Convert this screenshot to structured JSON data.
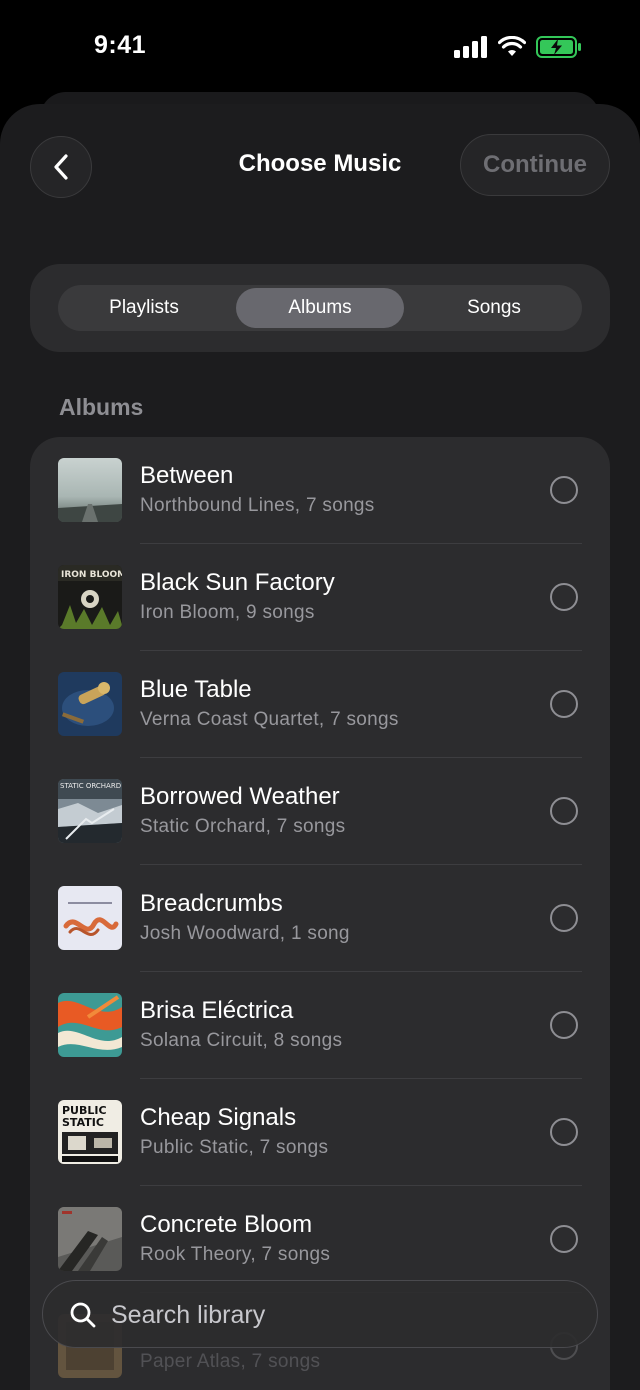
{
  "status": {
    "time": "9:41"
  },
  "header": {
    "title": "Choose Music",
    "continue_label": "Continue"
  },
  "segments": [
    {
      "label": "Playlists",
      "active": false
    },
    {
      "label": "Albums",
      "active": true
    },
    {
      "label": "Songs",
      "active": false
    }
  ],
  "section_title": "Albums",
  "albums": [
    {
      "title": "Between",
      "subtitle": "Northbound Lines, 7 songs"
    },
    {
      "title": "Black Sun Factory",
      "subtitle": "Iron Bloom, 9 songs"
    },
    {
      "title": "Blue Table",
      "subtitle": "Verna Coast Quartet, 7 songs"
    },
    {
      "title": "Borrowed Weather",
      "subtitle": "Static Orchard, 7 songs"
    },
    {
      "title": "Breadcrumbs",
      "subtitle": "Josh Woodward, 1 song"
    },
    {
      "title": "Brisa Eléctrica",
      "subtitle": "Solana Circuit, 8 songs"
    },
    {
      "title": "Cheap Signals",
      "subtitle": "Public Static, 7 songs"
    },
    {
      "title": "Concrete Bloom",
      "subtitle": "Rook Theory, 7 songs"
    },
    {
      "title": "",
      "subtitle": "Paper Atlas, 7 songs"
    }
  ],
  "search": {
    "placeholder": "Search library"
  },
  "colors": {
    "background": "#000000",
    "sheet": "#1c1c1e",
    "card": "#2c2c2e",
    "battery": "#34c759"
  }
}
